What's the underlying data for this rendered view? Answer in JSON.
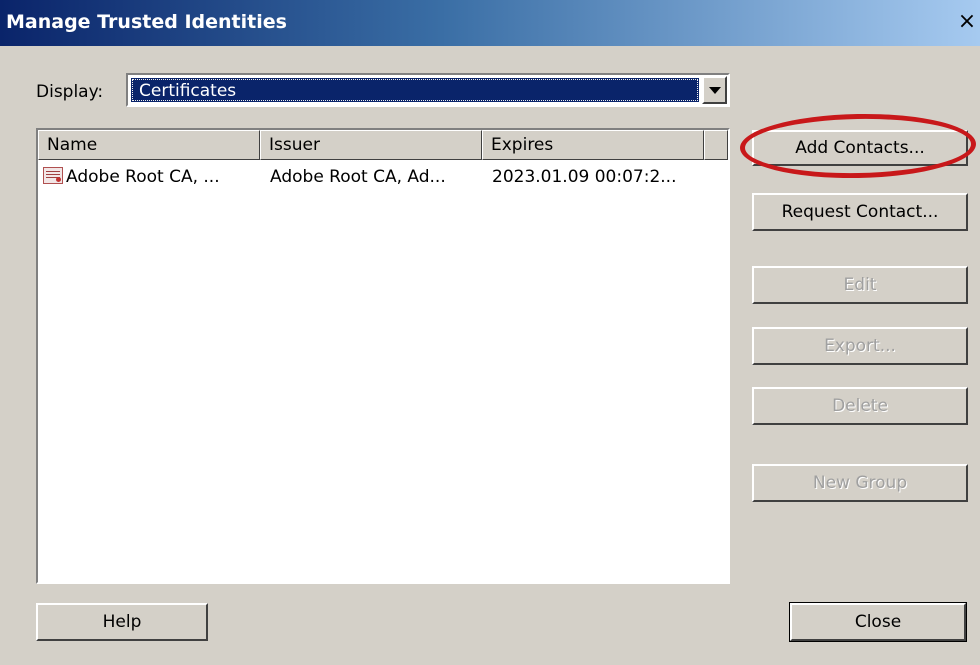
{
  "window": {
    "title": "Manage Trusted Identities",
    "close_glyph": "×"
  },
  "display": {
    "label": "Display:",
    "selected": "Certificates"
  },
  "list": {
    "columns": [
      "Name",
      "Issuer",
      "Expires"
    ],
    "rows": [
      {
        "name": "Adobe Root CA, ...",
        "issuer": "Adobe Root CA, Ad...",
        "expires": "2023.01.09 00:07:2..."
      }
    ]
  },
  "buttons": {
    "add_contacts": "Add Contacts...",
    "request_contact": "Request Contact...",
    "edit": "Edit",
    "export": "Export...",
    "delete": "Delete",
    "new_group": "New Group",
    "help": "Help",
    "close": "Close"
  },
  "annotation": {
    "color": "#c8181a",
    "target": "add_contacts"
  },
  "colors": {
    "dialog_bg": "#d4d0c8",
    "titlebar": "#0a246a",
    "selection": "#0a246a"
  }
}
